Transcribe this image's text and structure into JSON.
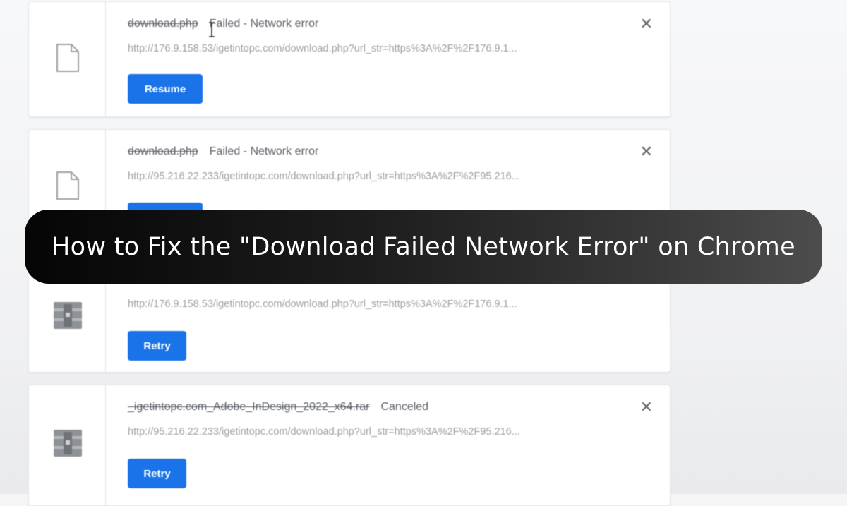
{
  "downloads": [
    {
      "filename": "download.php",
      "status": "Failed - Network error",
      "url": "http://176.9.158.53/igetintopc.com/download.php?url_str=https%3A%2F%2F176.9.1...",
      "action": "Resume",
      "icon": "file-icon"
    },
    {
      "filename": "download.php",
      "status": "Failed - Network error",
      "url": "http://95.216.22.233/igetintopc.com/download.php?url_str=https%3A%2F%2F95.216...",
      "action": "",
      "icon": "file-icon"
    },
    {
      "filename": "",
      "status": "",
      "url": "http://176.9.158.53/igetintopc.com/download.php?url_str=https%3A%2F%2F176.9.1...",
      "action": "Retry",
      "icon": "archive-icon"
    },
    {
      "filename": "_igetintopc.com_Adobe_InDesign_2022_x64.rar",
      "status": "Canceled",
      "url": "http://95.216.22.233/igetintopc.com/download.php?url_str=https%3A%2F%2F95.216...",
      "action": "Retry",
      "icon": "archive-icon"
    }
  ],
  "close_glyph": "✕",
  "banner": {
    "title": "How to Fix the \"Download Failed Network Error\" on Chrome"
  },
  "colors": {
    "button_blue": "#1a73e8",
    "banner_dark": "#050505"
  }
}
